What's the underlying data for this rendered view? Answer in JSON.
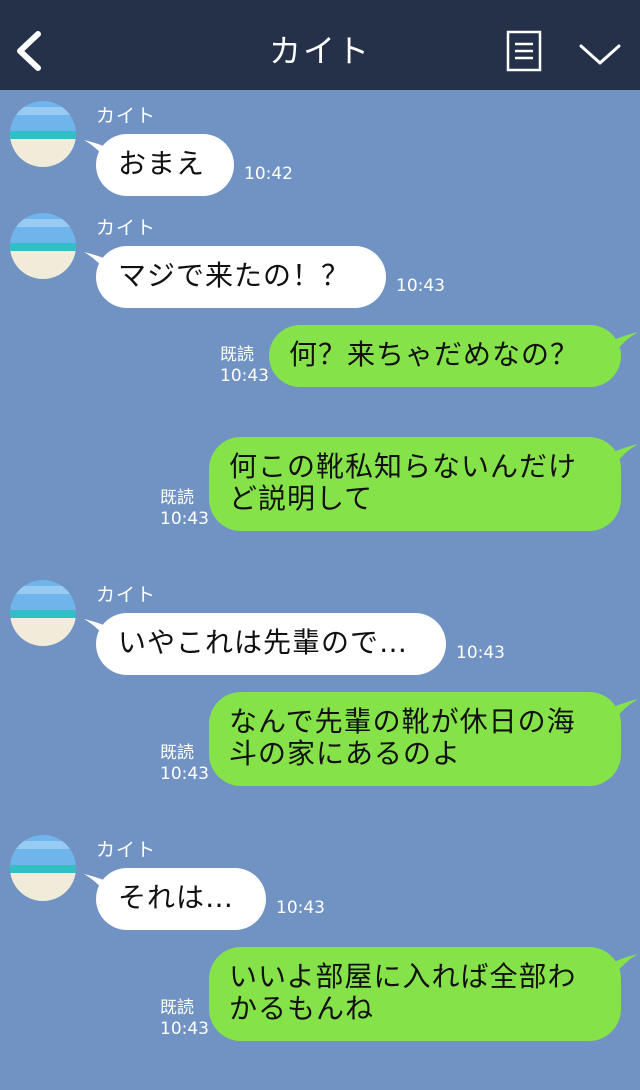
{
  "header": {
    "title": "カイト"
  },
  "messages": [
    {
      "sender": "カイト",
      "text": "おまえ",
      "time": "10:42"
    },
    {
      "sender": "カイト",
      "text": "マジで来たの！？",
      "time": "10:43"
    },
    {
      "read": "既読",
      "text": "何？来ちゃだめなの？",
      "time": "10:43"
    },
    {
      "read": "既読",
      "text": "何この靴私知らないんだけど説明して",
      "time": "10:43"
    },
    {
      "sender": "カイト",
      "text": "いやこれは先輩ので…",
      "time": "10:43"
    },
    {
      "read": "既読",
      "text": "なんで先輩の靴が休日の海斗の家にあるのよ",
      "time": "10:43"
    },
    {
      "sender": "カイト",
      "text": "それは…",
      "time": "10:43"
    },
    {
      "read": "既読",
      "text": "いいよ部屋に入れば全部わかるもんね",
      "time": "10:43"
    }
  ]
}
